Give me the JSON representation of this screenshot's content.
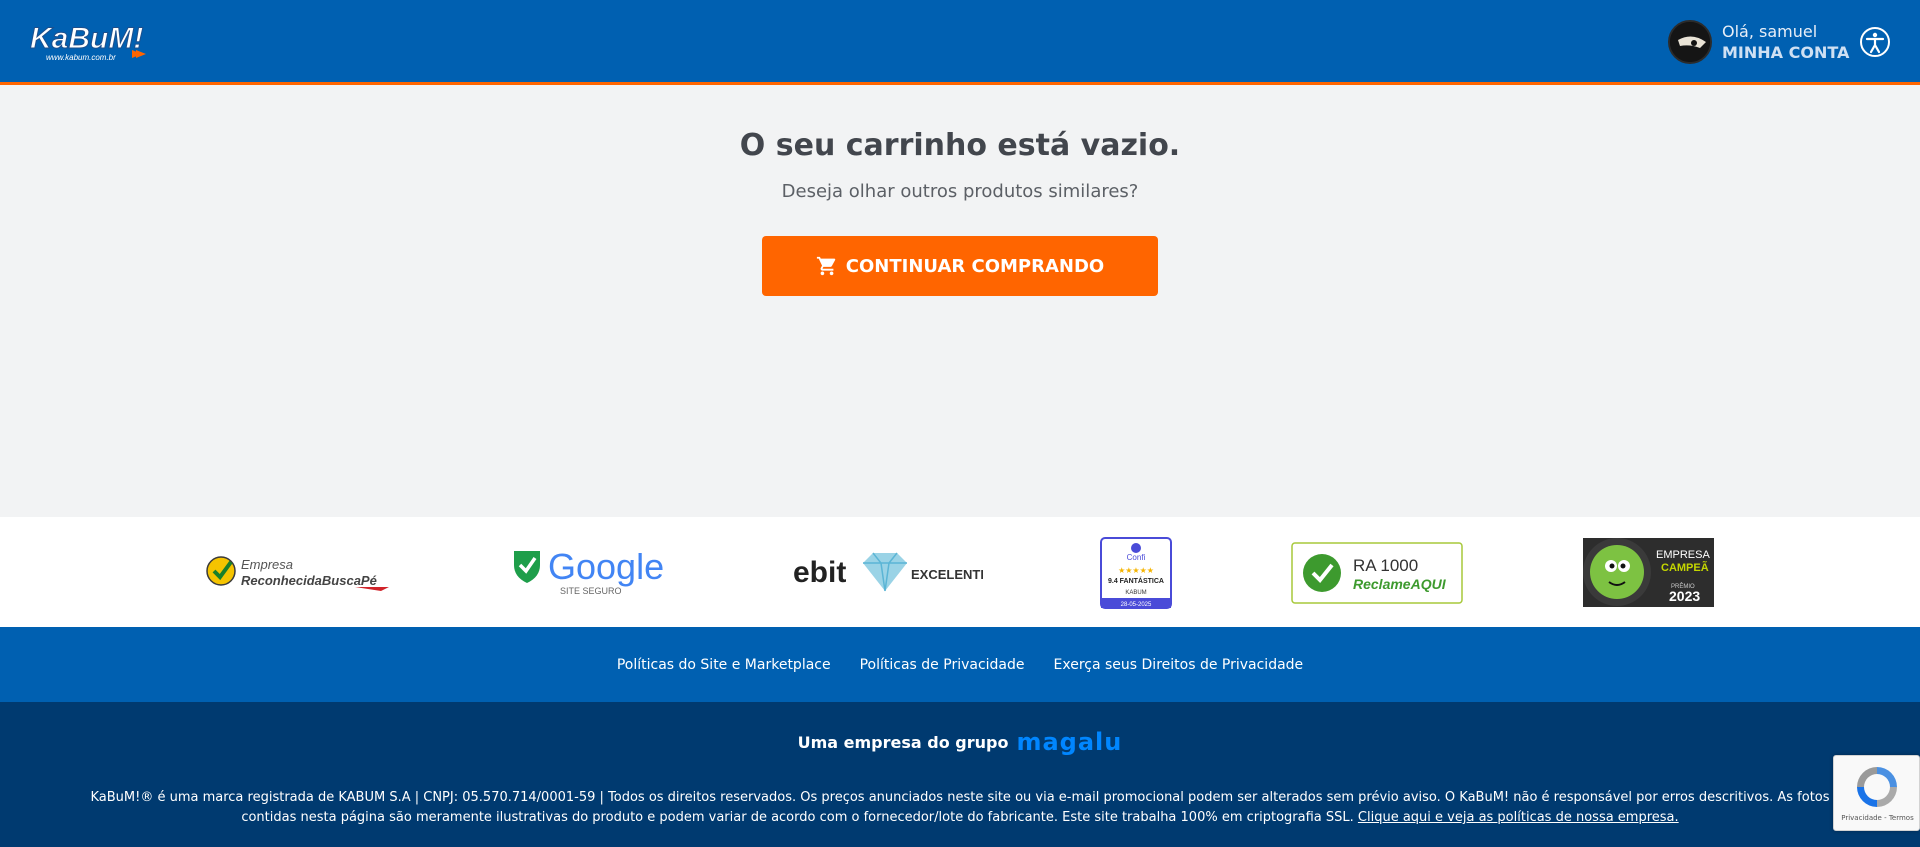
{
  "header": {
    "logo_text": "KaBuM!",
    "logo_url_text": "www.kabum.com.br",
    "greeting": "Olá, samuel",
    "account_label": "MINHA CONTA"
  },
  "main": {
    "title": "O seu carrinho está vazio.",
    "subtitle": "Deseja olhar outros produtos similares?",
    "cta_label": "CONTINUAR COMPRANDO"
  },
  "seals": {
    "buscape_line1": "Empresa",
    "buscape_line2": "ReconhecidaBuscaPé",
    "google_word": "Google",
    "google_sub": "SITE SEGURO",
    "ebit_word": "ebit",
    "ebit_level": "EXCELENTE",
    "confi_name": "Confi",
    "confi_stars": "★★★★★",
    "confi_score": "9.4 FANTÁSTICA",
    "confi_store": "KABUM",
    "confi_date": "28-05-2025",
    "ra_score": "RA 1000",
    "ra_brand": "ReclameAQUI",
    "champ_line1": "EMPRESA",
    "champ_line2": "CAMPEÃ",
    "champ_award": "PRÊMIO",
    "champ_year": "2023"
  },
  "links": [
    "Políticas do Site e Marketplace",
    "Políticas de Privacidade",
    "Exerça seus Direitos de Privacidade"
  ],
  "footer": {
    "group_text": "Uma empresa do grupo",
    "group_brand": "magalu",
    "legal_text": "KaBuM!® é uma marca registrada de KABUM S.A | CNPJ: 05.570.714/0001-59 | Todos os direitos reservados. Os preços anunciados neste site ou via e-mail promocional podem ser alterados sem prévio aviso. O KaBuM! não é responsável por erros descritivos. As fotos contidas nesta página são meramente ilustrativas do produto e podem variar de acordo com o fornecedor/lote do fabricante. Este site trabalha 100% em criptografia SSL.",
    "legal_link": " Clique aqui e veja as políticas de nossa empresa."
  },
  "recaptcha": {
    "label": "Privacidade - Termos"
  },
  "colors": {
    "brand_blue": "#0060b1",
    "accent_orange": "#ff6500",
    "footer_navy": "#003a70"
  }
}
